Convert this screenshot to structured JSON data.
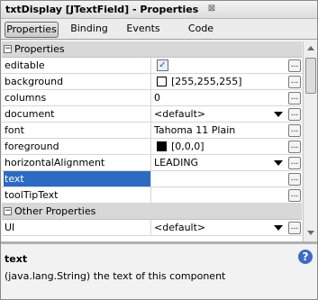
{
  "window": {
    "title": "txtDisplay [JTextField] - Properties",
    "close_glyph": "⊠"
  },
  "tabs": [
    {
      "label": "Properties",
      "active": true
    },
    {
      "label": "Binding",
      "active": false
    },
    {
      "label": "Events",
      "active": false
    },
    {
      "label": "Code",
      "active": false
    }
  ],
  "grid": {
    "ellipsis_label": "...",
    "categories": {
      "properties": {
        "label": "Properties",
        "toggle": "−"
      },
      "other": {
        "label": "Other Properties",
        "toggle": "−"
      }
    },
    "rows": {
      "editable": {
        "name": "editable",
        "checked": true,
        "check_glyph": "✓"
      },
      "background": {
        "name": "background",
        "value": "[255,255,255]",
        "swatch_color": "#ffffff"
      },
      "columns": {
        "name": "columns",
        "value": "0"
      },
      "document": {
        "name": "document",
        "value": "<default>"
      },
      "font": {
        "name": "font",
        "value": "Tahoma 11 Plain"
      },
      "foreground": {
        "name": "foreground",
        "value": "[0,0,0]",
        "swatch_color": "#000000"
      },
      "horizontalAlignment": {
        "name": "horizontalAlignment",
        "value": "LEADING"
      },
      "text": {
        "name": "text",
        "value": ""
      },
      "toolTipText": {
        "name": "toolTipText",
        "value": ""
      },
      "ui": {
        "name": "UI",
        "value": "<default>"
      }
    }
  },
  "description": {
    "title": "text",
    "text": "(java.lang.String) the text of this component",
    "help_glyph": "?"
  },
  "colors": {
    "selection": "#2d6bc3",
    "category_bg": "#d8d8d8",
    "help_icon": "#3f6bc4"
  }
}
